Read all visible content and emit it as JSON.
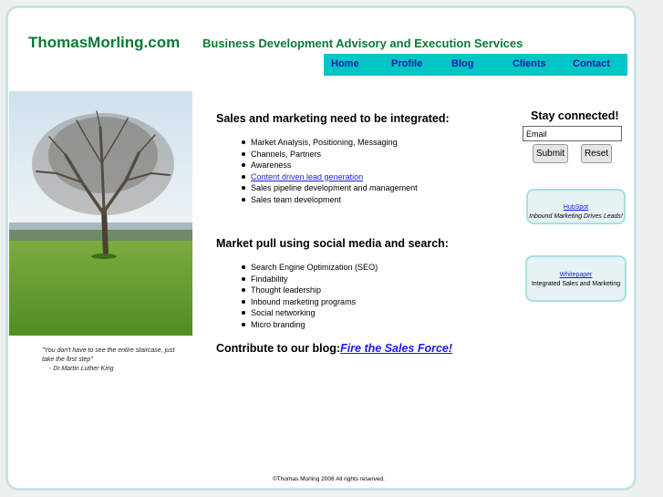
{
  "header": {
    "site_name": "ThomasMorling.com",
    "tagline": "Business Development Advisory and Execution Services"
  },
  "nav": {
    "items": [
      "Home",
      "Profile",
      "Blog",
      "Clients",
      "Contact"
    ],
    "bg_color": "#00c6c6",
    "link_color": "#1a1aa8"
  },
  "quote": {
    "text": "\"You don't have to see the entire staircase, just take the first step\"",
    "author": "- Dr.Martin Luther King"
  },
  "sections": [
    {
      "heading": "Sales and marketing need to be integrated:",
      "items": [
        "Market Analysis, Positioning, Messaging",
        "Channels, Partners",
        "Awareness",
        "Content driven lead generation",
        "Sales pipeline development and management",
        "Sales team development"
      ]
    },
    {
      "heading": "Market pull using social media and search:",
      "items": [
        "Search Engine Optimization (SEO)",
        "Findability",
        "Thought leadership",
        "Inbound marketing programs",
        "Social networking",
        "Micro branding"
      ]
    }
  ],
  "blog": {
    "prefix": "Contribute to our blog:",
    "link": "Fire the Sales Force!"
  },
  "sidebar": {
    "title": "Stay connected!",
    "email_value": "Email",
    "submit_label": "Submit",
    "reset_label": "Reset",
    "box1": {
      "link": "HubSpot",
      "desc": "Inbound Marketing Drives Leads!"
    },
    "box2": {
      "link": "Whitepaper",
      "desc": "Integrated Sales and Marketing"
    }
  },
  "footer": {
    "copyright": "©Thomas Morling 2008 All rights reserved."
  },
  "colors": {
    "brand_green": "#0b7a33",
    "frame_border": "#c6e3e6",
    "box_bg": "#e6f2f4"
  }
}
